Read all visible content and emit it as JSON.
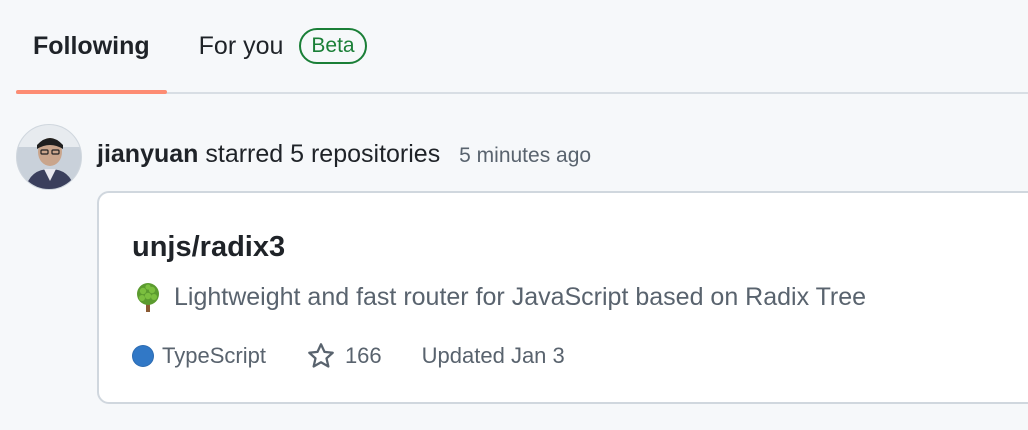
{
  "tabs": {
    "following": "Following",
    "for_you": "For you",
    "beta_badge": "Beta"
  },
  "feed_item": {
    "actor": "jianyuan",
    "action": "starred 5 repositories",
    "time": "5 minutes ago",
    "avatar_icon": "user-avatar",
    "repo": {
      "name": "unjs/radix3",
      "description_icon": "tree-emoji",
      "description": "Lightweight and fast router for JavaScript based on Radix Tree",
      "language": "TypeScript",
      "language_color": "#3178c6",
      "stars": "166",
      "updated": "Updated Jan 3"
    }
  },
  "colors": {
    "accent_underline": "#fd8c73",
    "beta_green": "#1a7f37",
    "page_bg": "#f6f8fa"
  }
}
